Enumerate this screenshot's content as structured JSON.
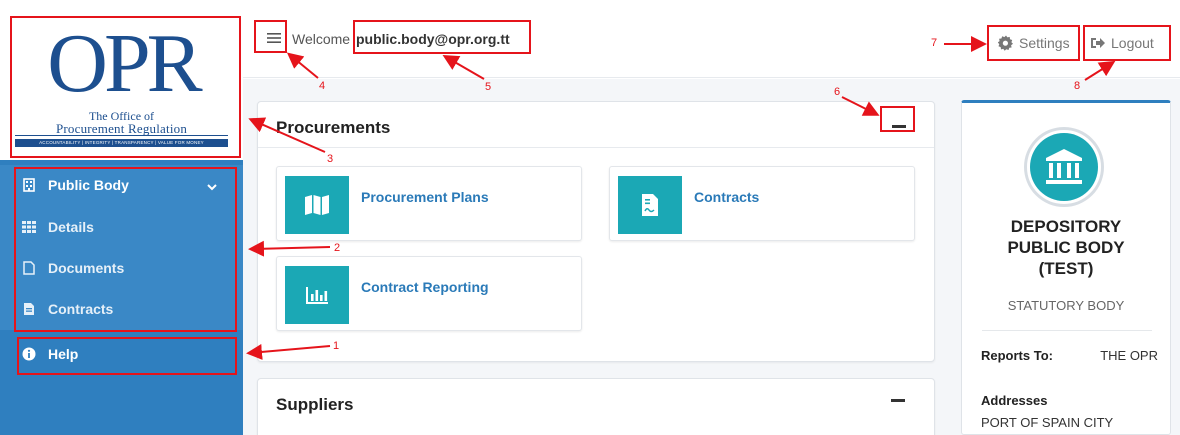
{
  "logo": {
    "letters": "OPR",
    "line1": "The Office of",
    "line2": "Procurement Regulation",
    "tagline": "ACCOUNTABILITY | INTEGRITY | TRANSPARENCY | VALUE FOR MONEY"
  },
  "sidebar": {
    "group_label": "Public Body",
    "items": [
      {
        "label": "Details",
        "icon": "grid-icon"
      },
      {
        "label": "Documents",
        "icon": "file-icon"
      },
      {
        "label": "Contracts",
        "icon": "file-filled-icon"
      }
    ],
    "help_label": "Help"
  },
  "header": {
    "welcome": "Welcome",
    "user_email": "public.body@opr.org.tt",
    "settings_label": "Settings",
    "logout_label": "Logout"
  },
  "procurements": {
    "title": "Procurements",
    "tiles": [
      {
        "label": "Procurement Plans",
        "icon": "map-icon"
      },
      {
        "label": "Contracts",
        "icon": "contract-file-icon"
      },
      {
        "label": "Contract Reporting",
        "icon": "bar-chart-icon"
      }
    ]
  },
  "suppliers": {
    "title": "Suppliers"
  },
  "profile": {
    "name": "DEPOSITORY PUBLIC BODY (TEST)",
    "type": "STATUTORY BODY",
    "reports_to_label": "Reports To:",
    "reports_to_value": "THE OPR",
    "addresses_label": "Addresses",
    "address_value": "PORT OF SPAIN CITY"
  },
  "annotations": [
    "1",
    "2",
    "3",
    "4",
    "5",
    "6",
    "7",
    "8"
  ],
  "colors": {
    "sidebar": "#2f7fbf",
    "accent": "#1ba8b5",
    "link": "#2a7ab8",
    "annotation": "#e5141b"
  }
}
